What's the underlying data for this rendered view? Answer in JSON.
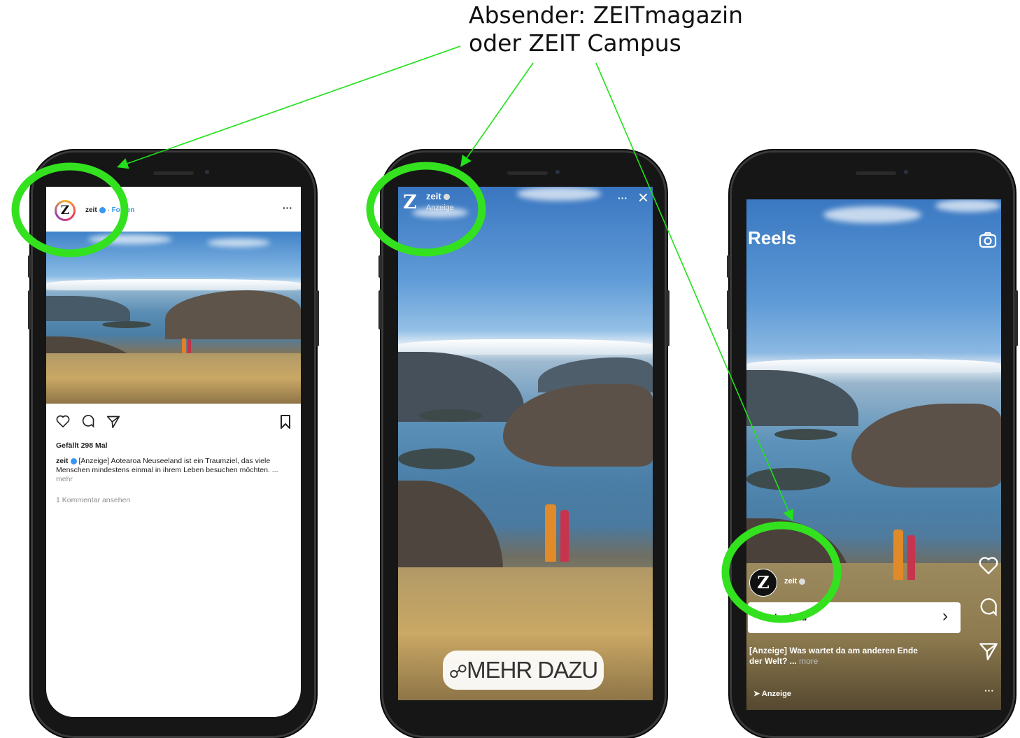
{
  "annotation": {
    "line1": "Absender: ZEITmagazin",
    "line2": "oder ZEIT Campus"
  },
  "colors": {
    "highlight": "#33e11f",
    "arrow": "#22e01a",
    "link": "#3897f0"
  },
  "feed": {
    "account": "zeit",
    "follow": "Folgen",
    "avatar_letter": "Z",
    "more": "···",
    "likes": "Gefällt 298 Mal",
    "caption_user": "zeit",
    "caption": "[Anzeige] Aotearoa Neuseeland ist ein Traumziel, das viele Menschen mindestens einmal in ihrem Leben besuchen möchten. ...",
    "caption_more": "mehr",
    "comments": "1 Kommentar ansehen",
    "icons": [
      "heart-icon",
      "comment-icon",
      "share-icon",
      "bookmark-icon"
    ]
  },
  "story": {
    "account": "zeit",
    "sponsored": "Anzeige",
    "avatar_letter": "Z",
    "more": "···",
    "close": "×",
    "cta": "MEHR DAZU"
  },
  "reels": {
    "title": "Reels",
    "account": "zeit",
    "avatar_letter": "Z",
    "cta": "Mehr dazu",
    "cta_arrow": "›",
    "caption": "[Anzeige] Was wartet da am anderen Ende der Welt? ...",
    "caption_more": "more",
    "sponsored": "Anzeige",
    "more": "···"
  }
}
